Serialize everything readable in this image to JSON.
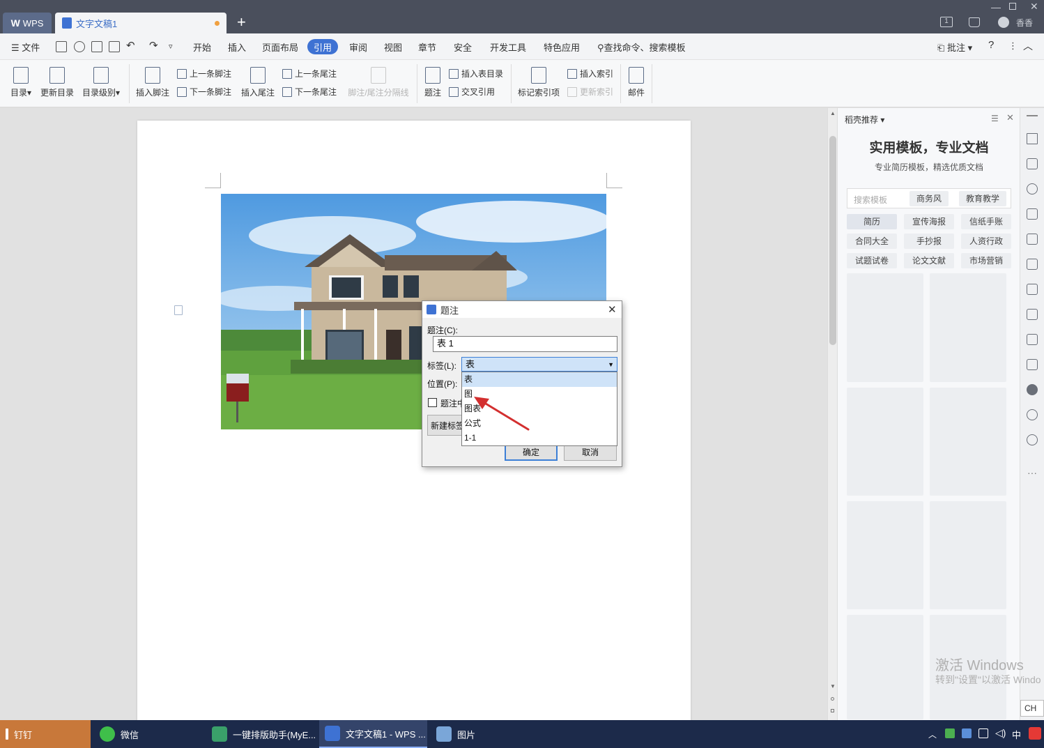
{
  "titlebar": {
    "wps_tab": "WPS",
    "doc_tab": "文字文稿1",
    "new_tab": "+",
    "badge": "1",
    "user": "香香"
  },
  "menubar": {
    "file": "文件",
    "items": [
      "开始",
      "插入",
      "页面布局",
      "引用",
      "审阅",
      "视图",
      "章节",
      "安全",
      "开发工具",
      "特色应用"
    ],
    "active": "引用",
    "search": "查找命令、搜索模板",
    "annotate": "批注",
    "help": "?"
  },
  "ribbon": {
    "toc": "目录",
    "update_toc": "更新目录",
    "toc_level": "目录级别",
    "insert_footnote": "插入脚注",
    "prev_footnote": "上一条脚注",
    "next_footnote": "下一条脚注",
    "insert_endnote": "插入尾注",
    "prev_endnote": "上一条尾注",
    "next_endnote": "下一条尾注",
    "separator": "脚注/尾注分隔线",
    "caption": "题注",
    "insert_table_of_figures": "插入表目录",
    "cross_reference": "交叉引用",
    "mark_index": "标记索引项",
    "insert_index": "插入索引",
    "update_index": "更新索引",
    "mail": "邮件"
  },
  "panel": {
    "title": "稻壳推荐",
    "headline": "实用模板，专业文档",
    "subline": "专业简历模板，精选优质文档",
    "search_placeholder": "搜索模板",
    "search_tags": [
      "商务风",
      "教育教学"
    ],
    "chips": [
      "简历",
      "宣传海报",
      "信纸手账",
      "合同大全",
      "手抄报",
      "人资行政",
      "试题试卷",
      "论文文献",
      "市场营销"
    ]
  },
  "dialog": {
    "title": "题注",
    "caption_label": "题注(C):",
    "caption_value": "表 1",
    "label_label": "标签(L):",
    "label_value": "表",
    "position_label": "位置(P):",
    "exclude_label": "题注中",
    "new_label_button": "新建标签",
    "ok": "确定",
    "cancel": "取消",
    "options": [
      "表",
      "图",
      "图表",
      "公式",
      "1-1"
    ]
  },
  "watermark": {
    "line1": "激活 Windows",
    "line2": "转到\"设置\"以激活 Windo",
    "ime": "CH"
  },
  "taskbar": {
    "items": [
      "钉钉",
      "微信",
      "一键排版助手(MyE...",
      "文字文稿1 - WPS ...",
      "图片"
    ],
    "tray": "中"
  },
  "colors": {
    "titlebar": "#4a4f5c",
    "accent": "#3e72d3",
    "taskbar": "#1c2a4a",
    "arrow": "#d32f2f"
  }
}
